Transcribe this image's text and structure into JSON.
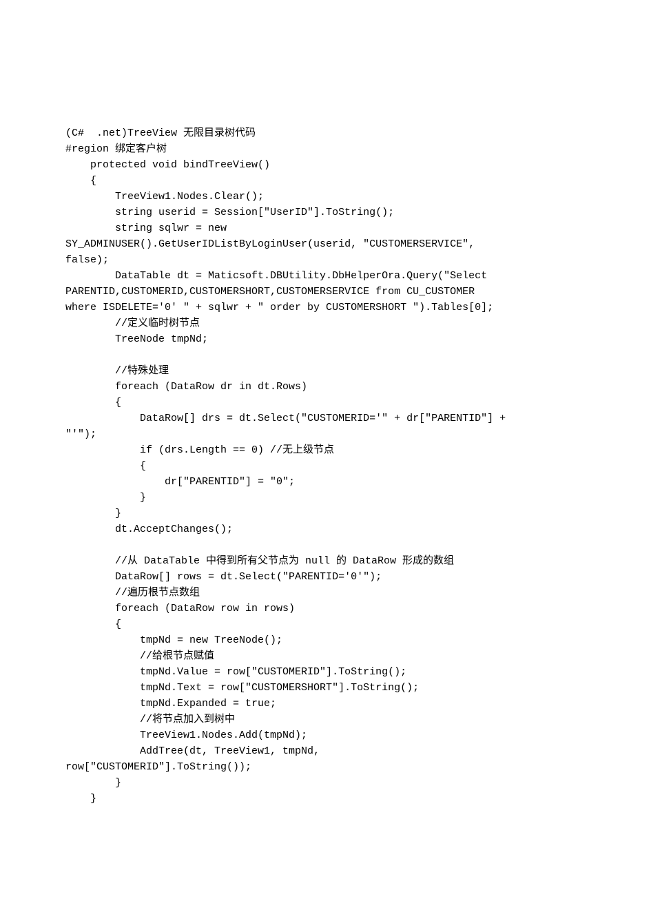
{
  "document": {
    "lines": [
      "(C#  .net)TreeView 无限目录树代码",
      "#region 绑定客户树",
      "    protected void bindTreeView()",
      "    {",
      "        TreeView1.Nodes.Clear();",
      "        string userid = Session[\"UserID\"].ToString();",
      "        string sqlwr = new ",
      "SY_ADMINUSER().GetUserIDListByLoginUser(userid, \"CUSTOMERSERVICE\", ",
      "false);",
      "        DataTable dt = Maticsoft.DBUtility.DbHelperOra.Query(\"Select ",
      "PARENTID,CUSTOMERID,CUSTOMERSHORT,CUSTOMERSERVICE from CU_CUSTOMER ",
      "where ISDELETE='0' \" + sqlwr + \" order by CUSTOMERSHORT \").Tables[0];",
      "        //定义临时树节点",
      "        TreeNode tmpNd;",
      "",
      "        //特殊处理",
      "        foreach (DataRow dr in dt.Rows)",
      "        {",
      "            DataRow[] drs = dt.Select(\"CUSTOMERID='\" + dr[\"PARENTID\"] + ",
      "\"'\");",
      "            if (drs.Length == 0) //无上级节点",
      "            {",
      "                dr[\"PARENTID\"] = \"0\";",
      "            }",
      "        }",
      "        dt.AcceptChanges();",
      "",
      "        //从 DataTable 中得到所有父节点为 null 的 DataRow 形成的数组",
      "        DataRow[] rows = dt.Select(\"PARENTID='0'\");",
      "        //遍历根节点数组",
      "        foreach (DataRow row in rows)",
      "        {",
      "            tmpNd = new TreeNode();",
      "            //给根节点赋值",
      "            tmpNd.Value = row[\"CUSTOMERID\"].ToString();",
      "            tmpNd.Text = row[\"CUSTOMERSHORT\"].ToString();",
      "            tmpNd.Expanded = true;",
      "            //将节点加入到树中",
      "            TreeView1.Nodes.Add(tmpNd);",
      "            AddTree(dt, TreeView1, tmpNd, ",
      "row[\"CUSTOMERID\"].ToString());",
      "        }",
      "    }"
    ]
  }
}
